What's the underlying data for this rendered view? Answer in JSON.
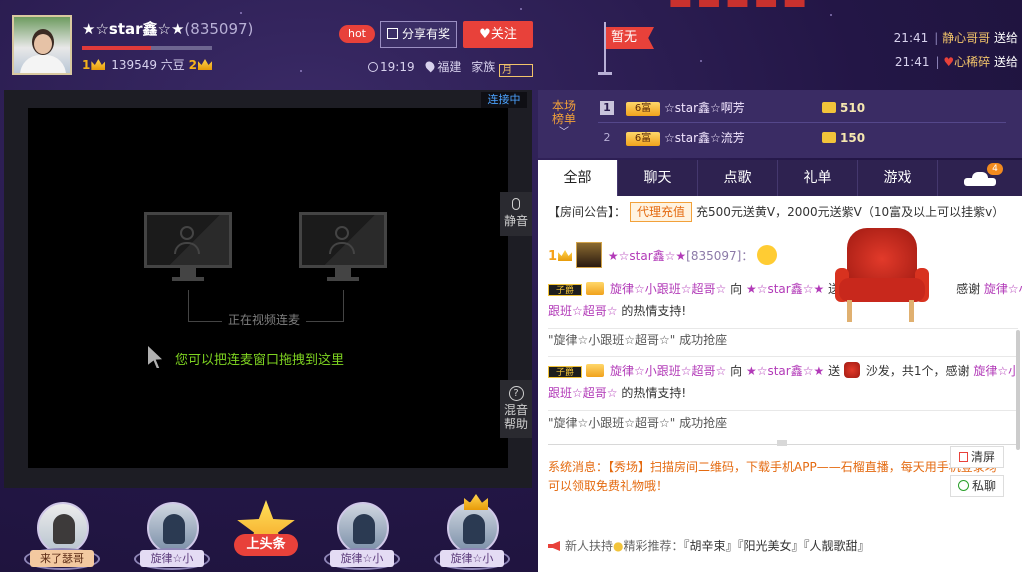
{
  "header": {
    "anchor_name": "★☆star鑫☆★",
    "room_id": "(835097)",
    "level_left": "1",
    "liudou": "139549 六豆",
    "level_right": "2",
    "hot_label": "hot",
    "share_label": "分享有奖",
    "follow_label": "关注",
    "time": "19:19",
    "location": "福建",
    "family_label": "家族",
    "family_value": "月",
    "flag_label": "暂无",
    "level_progress": 0.53,
    "gift_log": [
      {
        "time": "21:41",
        "user": "静心哥哥",
        "action": "送给"
      },
      {
        "time": "21:41",
        "user": "心稀碎",
        "action": "送给"
      }
    ]
  },
  "video": {
    "status": "连接中",
    "placeholder": "正在视频连麦",
    "drag_hint": "您可以把连麦窗口拖拽到这里",
    "mute_label": "静音",
    "help_label_1": "混音",
    "help_label_2": "帮助"
  },
  "seats": [
    {
      "name": "来了瑟哥"
    },
    {
      "name": "旋律☆小"
    },
    {
      "name": "上头条"
    },
    {
      "name": "旋律☆小"
    },
    {
      "name": "旋律☆小"
    }
  ],
  "rank": {
    "title_1": "本场",
    "title_2": "榜单",
    "rows": [
      {
        "no": "1",
        "medal": "6富",
        "name": "☆star鑫☆啊芳",
        "value": "510"
      },
      {
        "no": "2",
        "medal": "6富",
        "name": "☆star鑫☆流芳",
        "value": "150"
      }
    ]
  },
  "tabs": [
    "全部",
    "聊天",
    "点歌",
    "礼单",
    "游戏"
  ],
  "car_badge": "4",
  "chat": {
    "notice_prefix": "【房间公告】：",
    "notice_tag": "代理充值",
    "notice_text": "充500元送黄V，2000元送紫V（10富及以上可以挂紫v）",
    "msg1_level": "1",
    "msg1_user": "★☆star鑫☆★",
    "msg1_id": "[835097]：",
    "gift1_vip": "子爵",
    "gift1_user": "旋律☆小跟班☆超哥☆",
    "gift1_to": "向",
    "gift1_target": "★☆star鑫☆★",
    "gift1_send": "送",
    "gift1_thanks": "感谢",
    "gift1_user2a": "旋律☆小",
    "gift1_user2b": "跟班☆超哥☆",
    "gift1_suffix": "的热情支持!",
    "seat_msg1": "\"旋律☆小跟班☆超哥☆\" 成功抢座",
    "gift2_vip": "子爵",
    "gift2_user": "旋律☆小跟班☆超哥☆",
    "gift2_to": "向",
    "gift2_target": "★☆star鑫☆★",
    "gift2_send": "送",
    "gift2_item": "沙发，共1个，感谢",
    "gift2_user2a": "旋律☆小",
    "gift2_user2b": "跟班☆超哥☆",
    "gift2_suffix": "的热情支持!",
    "seat_msg2": "\"旋律☆小跟班☆超哥☆\" 成功抢座",
    "sys_label": "系统消息：",
    "sys_text_1": "【秀场】扫描房间二维码，下载手机APP——石榴直播，每天用手机登录均",
    "sys_text_2": "可以领取免费礼物哦！",
    "clear_label": "清屏",
    "pm_label": "私聊",
    "newbie_label": "新人扶持",
    "newbie_mid": "精彩推荐：",
    "rec_1": "『胡辛束』",
    "rec_2": "『阳光美女』",
    "rec_3": "『人靓歌甜』"
  }
}
